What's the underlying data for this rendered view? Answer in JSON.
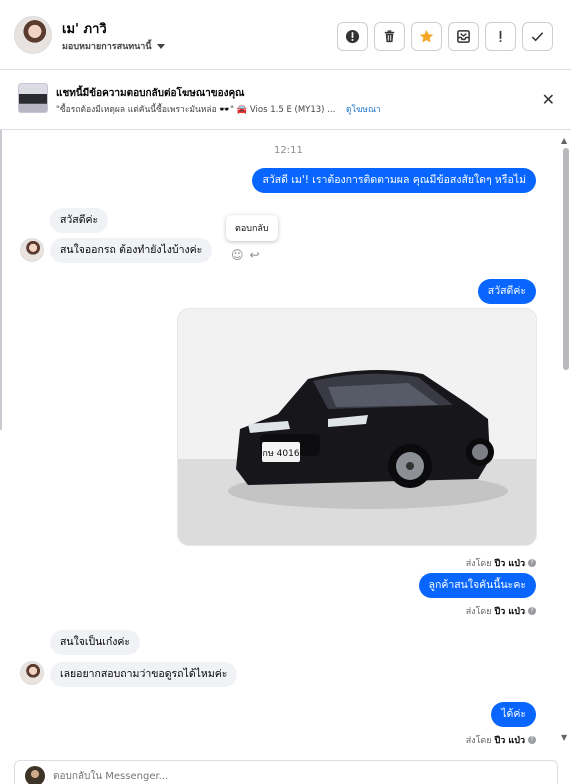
{
  "header": {
    "contact_name": "เม' ภาวิ",
    "assign_label": "มอบหมายการสนทนานี้",
    "toolbar": [
      {
        "name": "spam-button",
        "icon": "alert-circle-icon"
      },
      {
        "name": "delete-button",
        "icon": "trash-icon"
      },
      {
        "name": "star-button",
        "icon": "star-icon",
        "color": "#f5a623"
      },
      {
        "name": "archive-button",
        "icon": "inbox-icon"
      },
      {
        "name": "followup-button",
        "icon": "exclamation-icon"
      },
      {
        "name": "done-button",
        "icon": "check-icon"
      }
    ]
  },
  "ad_banner": {
    "title": "แชทนี้มีข้อความตอบกลับต่อโฆษณาของคุณ",
    "subtitle": "\"ซื้อรถต้องมีเหตุผล แต่คันนี้ซื้อเพราะมันหล่อ 🕶️\" 🚘 Vios 1.5 E (MY13) ...",
    "link": "ดูโฆษณา",
    "close_icon": "close-icon"
  },
  "conversation": {
    "timestamp": "12:11",
    "messages": [
      {
        "id": "m1",
        "direction": "outgoing",
        "text": "สวัสดี เม'! เราต้องการติดตามผล คุณมีข้อสงสัยใดๆ หรือไม่"
      },
      {
        "id": "m2",
        "direction": "incoming",
        "text": "สวัสดีค่ะ"
      },
      {
        "id": "m3",
        "direction": "incoming",
        "text": "สนใจออกรถ ต้องทำยังไงบ้างค่ะ"
      },
      {
        "id": "m4",
        "direction": "outgoing",
        "text": "สวัสดีค่ะ"
      },
      {
        "id": "m5",
        "direction": "outgoing",
        "type": "image",
        "alt": "Black Toyota Vios sedan in white studio, plate กษ 4016"
      },
      {
        "id": "m6",
        "direction": "outgoing",
        "text": "ลูกค้าสนใจคันนี้นะคะ"
      },
      {
        "id": "m7",
        "direction": "incoming",
        "text": "สนใจเป็นเก๋งค่ะ"
      },
      {
        "id": "m8",
        "direction": "incoming",
        "text": "เลยอยากสอบถามว่าขอดูรถได้ไหมค่ะ"
      },
      {
        "id": "m9",
        "direction": "outgoing",
        "text": "ได้ค่ะ"
      }
    ],
    "tooltip": "ตอบกลับ",
    "sent_by_prefix": "ส่งโดย",
    "sent_by_name": "ปีว แป่ว",
    "plate_text": "กษ 4016"
  },
  "composer": {
    "placeholder": "ตอบกลับใน Messenger..."
  },
  "colors": {
    "outgoing_bubble": "#0866ff",
    "incoming_bubble": "#f0f2f5",
    "link": "#1a73c8"
  }
}
